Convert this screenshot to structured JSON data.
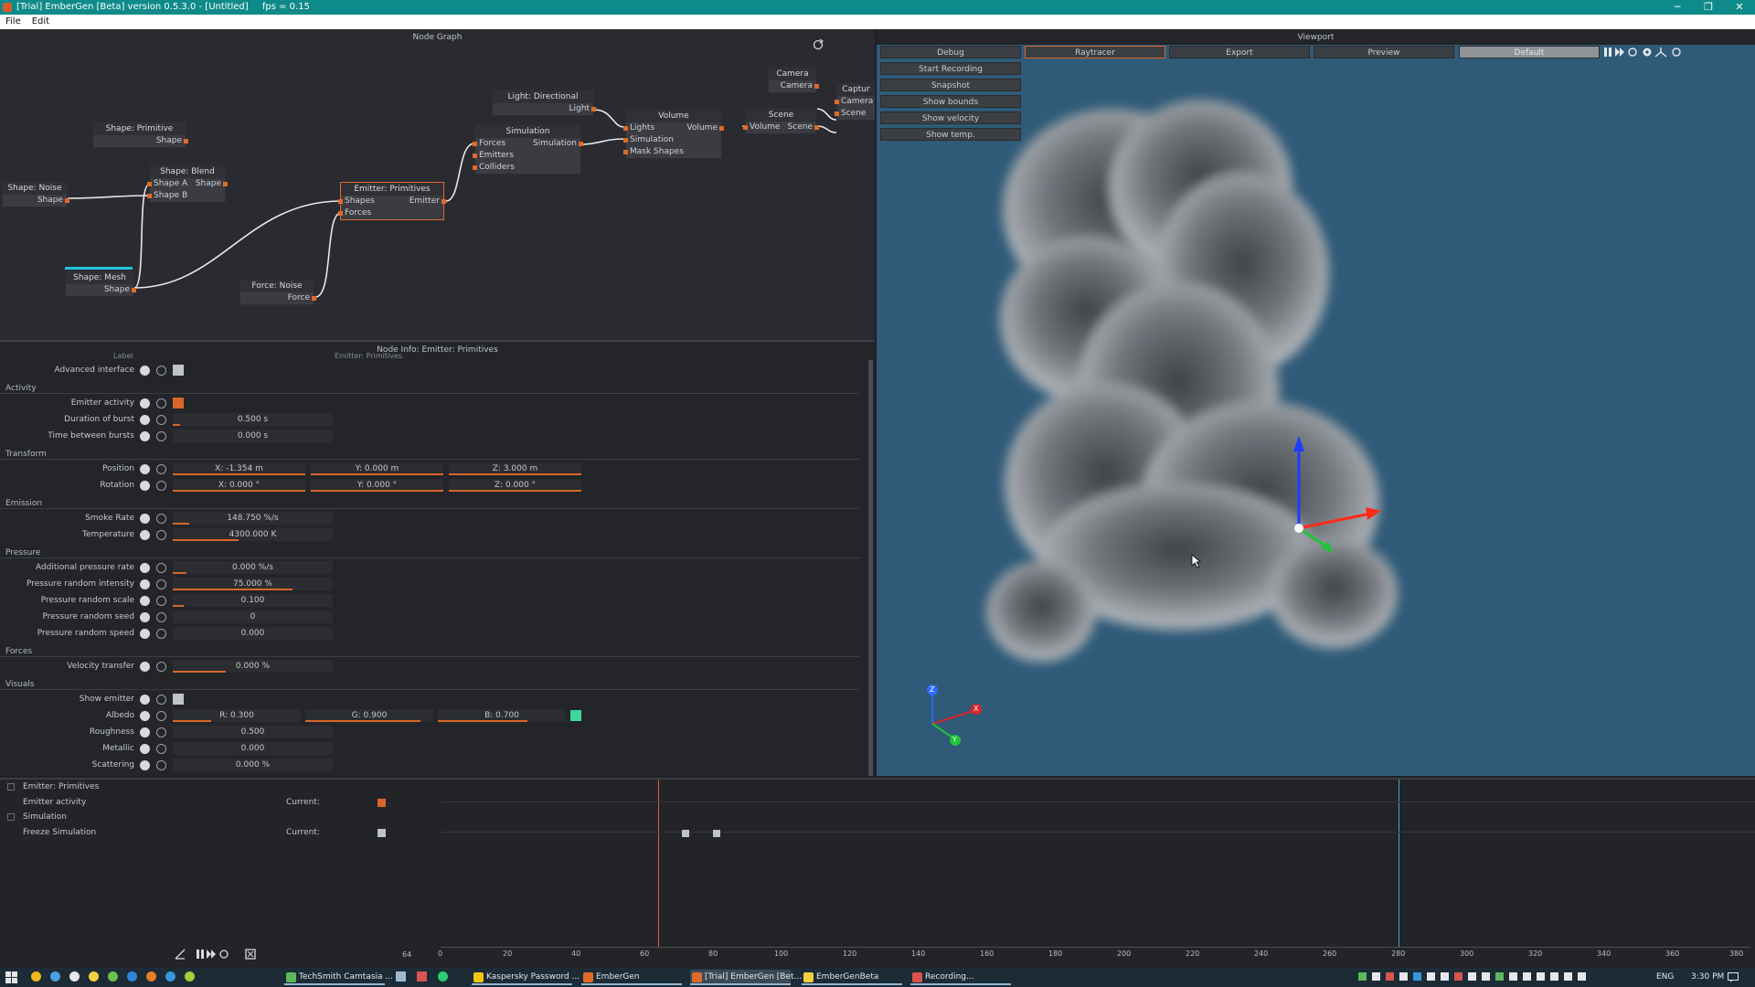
{
  "window": {
    "title": "[Trial] EmberGen [Beta] version 0.5.3.0 - [Untitled]",
    "fps": "fps = 0.15",
    "minimize": "─",
    "restore": "❐",
    "close": "✕"
  },
  "menu": {
    "file": "File",
    "edit": "Edit"
  },
  "node_graph": {
    "title": "Node Graph",
    "nodes": {
      "shape_primitive": {
        "title": "Shape: Primitive",
        "out": "Shape"
      },
      "shape_noise": {
        "title": "Shape: Noise",
        "out": "Shape"
      },
      "shape_blend": {
        "title": "Shape: Blend",
        "in1": "Shape A",
        "in2": "Shape B",
        "out": "Shape"
      },
      "shape_mesh": {
        "title": "Shape: Mesh",
        "out": "Shape"
      },
      "force_noise": {
        "title": "Force: Noise",
        "out": "Force"
      },
      "emitter": {
        "title": "Emitter: Primitives",
        "in1": "Shapes",
        "in2": "Forces",
        "out": "Emitter"
      },
      "light": {
        "title": "Light: Directional",
        "out": "Light"
      },
      "simulation": {
        "title": "Simulation",
        "in1": "Forces",
        "in2": "Emitters",
        "in3": "Colliders",
        "out": "Simulation"
      },
      "volume": {
        "title": "Volume",
        "in1": "Lights",
        "in2": "Simulation",
        "in3": "Mask Shapes",
        "out": "Volume"
      },
      "scene": {
        "title": "Scene",
        "in1": "Volume",
        "out": "Scene"
      },
      "camera": {
        "title": "Camera",
        "out": "Camera"
      },
      "capture": {
        "title": "Captur",
        "in1": "Camera",
        "in2": "Scene"
      }
    }
  },
  "node_info": {
    "title": "Node Info: Emitter: Primitives",
    "label_header": "Label",
    "label_value": "Emitter: Primitives",
    "advanced": "Advanced interface",
    "sections": {
      "activity": "Activity",
      "transform": "Transform",
      "emission": "Emission",
      "pressure": "Pressure",
      "forces": "Forces",
      "visuals": "Visuals"
    },
    "rows": {
      "emitter_activity": "Emitter activity",
      "duration": {
        "label": "Duration of burst",
        "value": "0.500 s"
      },
      "time_between": {
        "label": "Time between bursts",
        "value": "0.000 s"
      },
      "position": {
        "label": "Position",
        "x": "X: -1.354 m",
        "y": "Y: 0.000 m",
        "z": "Z: 3.000 m"
      },
      "rotation": {
        "label": "Rotation",
        "x": "X: 0.000 °",
        "y": "Y: 0.000 °",
        "z": "Z: 0.000 °"
      },
      "smoke_rate": {
        "label": "Smoke Rate",
        "value": "148.750 %/s"
      },
      "temperature": {
        "label": "Temperature",
        "value": "4300.000 K"
      },
      "add_pressure": {
        "label": "Additional pressure rate",
        "value": "0.000 %/s"
      },
      "pr_intensity": {
        "label": "Pressure random intensity",
        "value": "75.000 %"
      },
      "pr_scale": {
        "label": "Pressure random scale",
        "value": "0.100"
      },
      "pr_seed": {
        "label": "Pressure random seed",
        "value": "0"
      },
      "pr_speed": {
        "label": "Pressure random speed",
        "value": "0.000"
      },
      "velocity_transfer": {
        "label": "Velocity transfer",
        "value": "0.000 %"
      },
      "show_emitter": "Show emitter",
      "albedo": {
        "label": "Albedo",
        "r": "R: 0.300",
        "g": "G: 0.900",
        "b": "B: 0.700",
        "swatch": "#3fd6a0"
      },
      "roughness": {
        "label": "Roughness",
        "value": "0.500"
      },
      "metallic": {
        "label": "Metallic",
        "value": "0.000"
      },
      "scattering": {
        "label": "Scattering",
        "value": "0.000 %"
      }
    }
  },
  "viewport": {
    "title": "Viewport",
    "tabs": [
      "Debug",
      "Raytracer",
      "Export",
      "Preview",
      "Default"
    ],
    "buttons": [
      "Start Recording",
      "Snapshot",
      "Show bounds",
      "Show velocity",
      "Show temp."
    ],
    "axes": {
      "x": "X",
      "y": "Y",
      "z": "Z"
    }
  },
  "timeline": {
    "groups": [
      {
        "name": "Emitter: Primitives",
        "track": "Emitter activity",
        "current": "Current:"
      },
      {
        "name": "Simulation",
        "track": "Freeze Simulation",
        "current": "Current:"
      }
    ],
    "frame": "64",
    "ticks": [
      "0",
      "20",
      "40",
      "60",
      "80",
      "100",
      "120",
      "140",
      "160",
      "180",
      "200",
      "220",
      "240",
      "260",
      "280",
      "300",
      "320",
      "340",
      "360",
      "380"
    ]
  },
  "taskbar": {
    "items": [
      "TechSmith Camtasia ...",
      "Kaspersky Password ...",
      "EmberGen",
      "[Trial] EmberGen [Bet...",
      "EmberGenBeta",
      "Recording..."
    ],
    "lang": "ENG",
    "time": "3:30 PM"
  }
}
